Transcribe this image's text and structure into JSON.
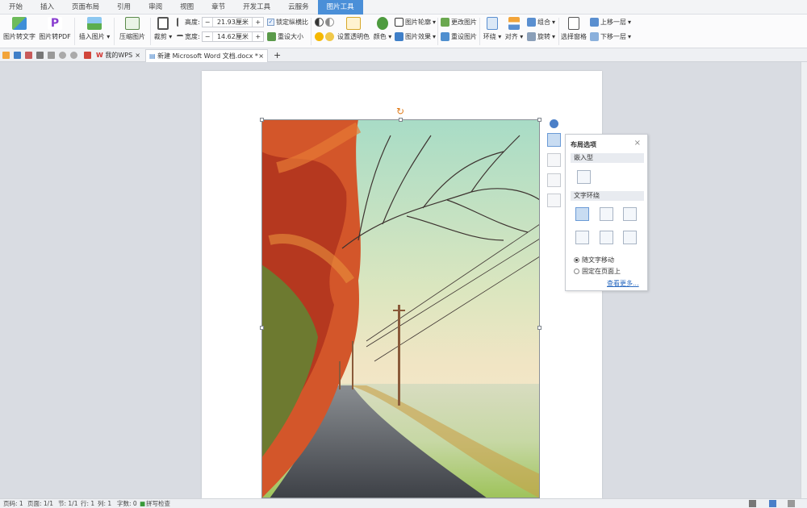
{
  "menubar": {
    "tabs": [
      "开始",
      "插入",
      "页面布局",
      "引用",
      "审阅",
      "视图",
      "章节",
      "开发工具",
      "云服务",
      "图片工具"
    ],
    "active_tab": "图片工具"
  },
  "ribbon": {
    "pic_to_text": "图片转文字",
    "pic_to_pdf": "图片转PDF",
    "insert_picture": "插入图片",
    "compress_picture": "压缩图片",
    "crop": "裁剪",
    "height_label": "高度:",
    "height_value": "21.93厘米",
    "width_label": "宽度:",
    "width_value": "14.62厘米",
    "lock_ratio": "锁定纵横比",
    "reset_size": "重设大小",
    "set_transparent": "设置透明色",
    "color": "颜色",
    "picture_outline": "图片轮廓",
    "picture_effect": "图片效果",
    "change_picture": "更改图片",
    "reset_picture": "重设图片",
    "wrap": "环绕",
    "align": "对齐",
    "group": "组合",
    "rotate": "旋转",
    "selection_pane": "选择窗格",
    "bring_forward": "上移一层",
    "send_backward": "下移一层"
  },
  "tabs": {
    "my_wps": "我的WPS",
    "document": "新建 Microsoft Word 文档.docx *",
    "close_icon": "×",
    "new_tab": "+"
  },
  "popup": {
    "title": "布局选项",
    "close": "×",
    "inline_section": "嵌入型",
    "wrap_section": "文字环绕",
    "move_with_text": "随文字移动",
    "fix_on_page": "固定在页面上",
    "see_more": "查看更多..."
  },
  "status": {
    "page_no": "页码: 1",
    "pages": "页面: 1/1",
    "section": "节: 1/1",
    "row": "行: 1",
    "col": "列: 1",
    "word_count": "字数: 0",
    "spell_check": "拼写检查"
  },
  "colors": {
    "accent": "#4a8fd8",
    "workspace": "#d9dce2",
    "link": "#2a6ac0"
  }
}
